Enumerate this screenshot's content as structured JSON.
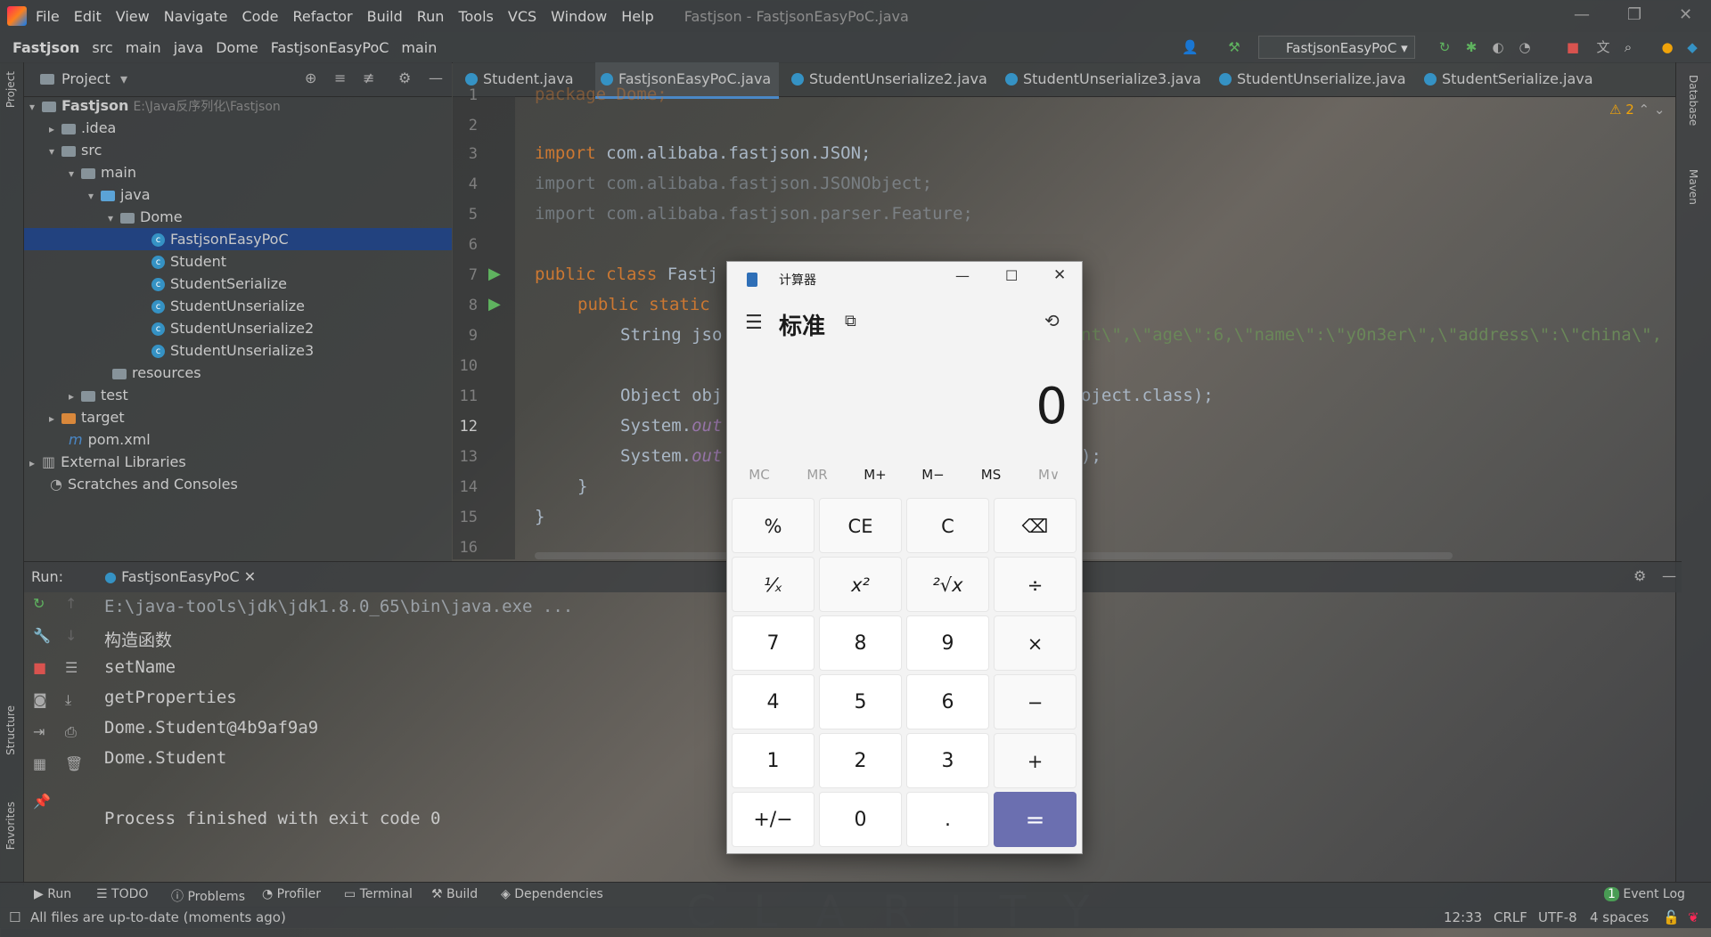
{
  "menubar": {
    "items": [
      "File",
      "Edit",
      "View",
      "Navigate",
      "Code",
      "Refactor",
      "Build",
      "Run",
      "Tools",
      "VCS",
      "Window",
      "Help"
    ],
    "window_title": "Fastjson - FastjsonEasyPoC.java"
  },
  "navbar": {
    "crumbs": [
      "Fastjson",
      "src",
      "main",
      "java",
      "Dome",
      "FastjsonEasyPoC",
      "main"
    ],
    "run_config": "FastjsonEasyPoC"
  },
  "project": {
    "header": "Project",
    "root_name": "Fastjson",
    "root_path": "E:\\Java反序列化\\Fastjson",
    "tree": [
      {
        "label": ".idea"
      },
      {
        "label": "src"
      },
      {
        "label": "main"
      },
      {
        "label": "java"
      },
      {
        "label": "Dome"
      },
      {
        "label": "FastjsonEasyPoC"
      },
      {
        "label": "Student"
      },
      {
        "label": "StudentSerialize"
      },
      {
        "label": "StudentUnserialize"
      },
      {
        "label": "StudentUnserialize2"
      },
      {
        "label": "StudentUnserialize3"
      },
      {
        "label": "resources"
      },
      {
        "label": "test"
      },
      {
        "label": "target"
      },
      {
        "label": "pom.xml"
      },
      {
        "label": "External Libraries"
      },
      {
        "label": "Scratches and Consoles"
      }
    ]
  },
  "editor": {
    "tabs": [
      "Student.java",
      "FastjsonEasyPoC.java",
      "StudentUnserialize2.java",
      "StudentUnserialize3.java",
      "StudentUnserialize.java",
      "StudentSerialize.java"
    ],
    "warnings": "2",
    "line_numbers": [
      "1",
      "2",
      "3",
      "4",
      "5",
      "6",
      "7",
      "8",
      "9",
      "10",
      "11",
      "12",
      "13",
      "14",
      "15",
      "16"
    ],
    "code": {
      "l1": "package Dome;",
      "l3_kw": "import",
      "l3": " com.alibaba.fastjson.JSON;",
      "l4": "import com.alibaba.fastjson.JSONObject;",
      "l5": "import com.alibaba.fastjson.parser.Feature;",
      "l7_kw": "public class",
      "l7": " Fastj",
      "l8_kw": "public static",
      "l9": "String jso",
      "l9_right": "nt\\\",\\\"age\\\":6,\\\"name\\\":\\\"y0n3er\\\",\\\"address\\\":\\\"china\\\",",
      "l11": "Object obj",
      "l11_right": "oject.class);",
      "l12a": "System.",
      "l12b": "out",
      "l13a": "System.",
      "l13b": "out",
      "l13_right": ");",
      "l14": "}",
      "l15": "}"
    }
  },
  "run": {
    "label": "Run:",
    "tab": "FastjsonEasyPoC",
    "output": [
      "E:\\java-tools\\jdk\\jdk1.8.0_65\\bin\\java.exe ...",
      "构造函数",
      "setName",
      "getProperties",
      "Dome.Student@4b9af9a9",
      "Dome.Student",
      "",
      "Process finished with exit code 0"
    ]
  },
  "left_strip": {
    "project": "Project",
    "structure": "Structure",
    "favorites": "Favorites"
  },
  "right_strip": {
    "database": "Database",
    "maven": "Maven"
  },
  "bottom_tools": [
    "Run",
    "TODO",
    "Problems",
    "Profiler",
    "Terminal",
    "Build",
    "Dependencies"
  ],
  "event_log": {
    "count": "1",
    "label": "Event Log"
  },
  "status": {
    "message": "All files are up-to-date (moments ago)",
    "position": "12:33",
    "line_sep": "CRLF",
    "encoding": "UTF-8",
    "indent": "4 spaces"
  },
  "watermark": "CLARITY",
  "calculator": {
    "title": "计算器",
    "mode": "标准",
    "display": "0",
    "memory": [
      "MC",
      "MR",
      "M+",
      "M−",
      "MS",
      "M∨"
    ],
    "keys": [
      [
        "%",
        "CE",
        "C",
        "⌫"
      ],
      [
        "¹⁄ₓ",
        "x²",
        "²√x",
        "÷"
      ],
      [
        "7",
        "8",
        "9",
        "×"
      ],
      [
        "4",
        "5",
        "6",
        "−"
      ],
      [
        "1",
        "2",
        "3",
        "+"
      ],
      [
        "+/−",
        "0",
        ".",
        "="
      ]
    ]
  },
  "colors": {
    "accent": "#6b6fb0",
    "selection": "#214283",
    "keyword": "#cc7832",
    "string": "#6a8759"
  }
}
